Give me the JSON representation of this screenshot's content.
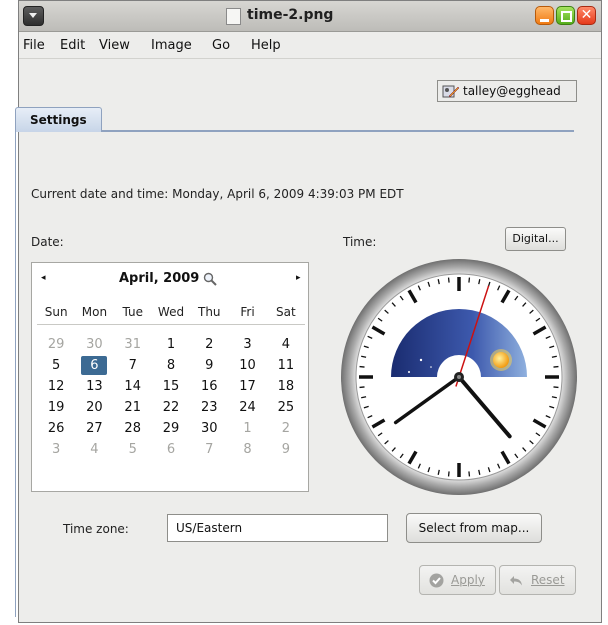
{
  "window": {
    "title": "time-2.png"
  },
  "menu": [
    "File",
    "Edit",
    "View",
    "Image",
    "Go",
    "Help"
  ],
  "user": {
    "label": "talley@egghead"
  },
  "tabs": [
    {
      "label": "Settings"
    }
  ],
  "current": {
    "text": "Current date and time:  Monday, April 6, 2009 4:39:03 PM EDT"
  },
  "date_label": "Date:",
  "time_label": "Time:",
  "digital_button": "Digital...",
  "calendar": {
    "title": "April, 2009",
    "prev": "◂",
    "next": "▸",
    "weekdays": [
      "Sun",
      "Mon",
      "Tue",
      "Wed",
      "Thu",
      "Fri",
      "Sat"
    ],
    "weeks": [
      [
        "29",
        "30",
        "31",
        "1",
        "2",
        "3",
        "4"
      ],
      [
        "5",
        "6",
        "7",
        "8",
        "9",
        "10",
        "11"
      ],
      [
        "12",
        "13",
        "14",
        "15",
        "16",
        "17",
        "18"
      ],
      [
        "19",
        "20",
        "21",
        "22",
        "23",
        "24",
        "25"
      ],
      [
        "26",
        "27",
        "28",
        "29",
        "30",
        "1",
        "2"
      ],
      [
        "3",
        "4",
        "5",
        "6",
        "7",
        "8",
        "9"
      ]
    ],
    "muted_cells": [
      [
        0,
        0
      ],
      [
        0,
        1
      ],
      [
        0,
        2
      ],
      [
        4,
        5
      ],
      [
        4,
        6
      ],
      [
        5,
        0
      ],
      [
        5,
        1
      ],
      [
        5,
        2
      ],
      [
        5,
        3
      ],
      [
        5,
        4
      ],
      [
        5,
        5
      ],
      [
        5,
        6
      ]
    ],
    "selected_cell": [
      1,
      1
    ]
  },
  "clock": {
    "hours": 4,
    "minutes": 39,
    "seconds": 3
  },
  "timezone": {
    "label": "Time zone:",
    "value": "US/Eastern",
    "map_button": "Select from map..."
  },
  "buttons": {
    "apply": "Apply",
    "reset": "Reset"
  },
  "colors": {
    "tab_border": "#8fa2bf",
    "selected_day": "#3c6a93",
    "second_hand": "#cc1111",
    "sky": "#233a82"
  }
}
